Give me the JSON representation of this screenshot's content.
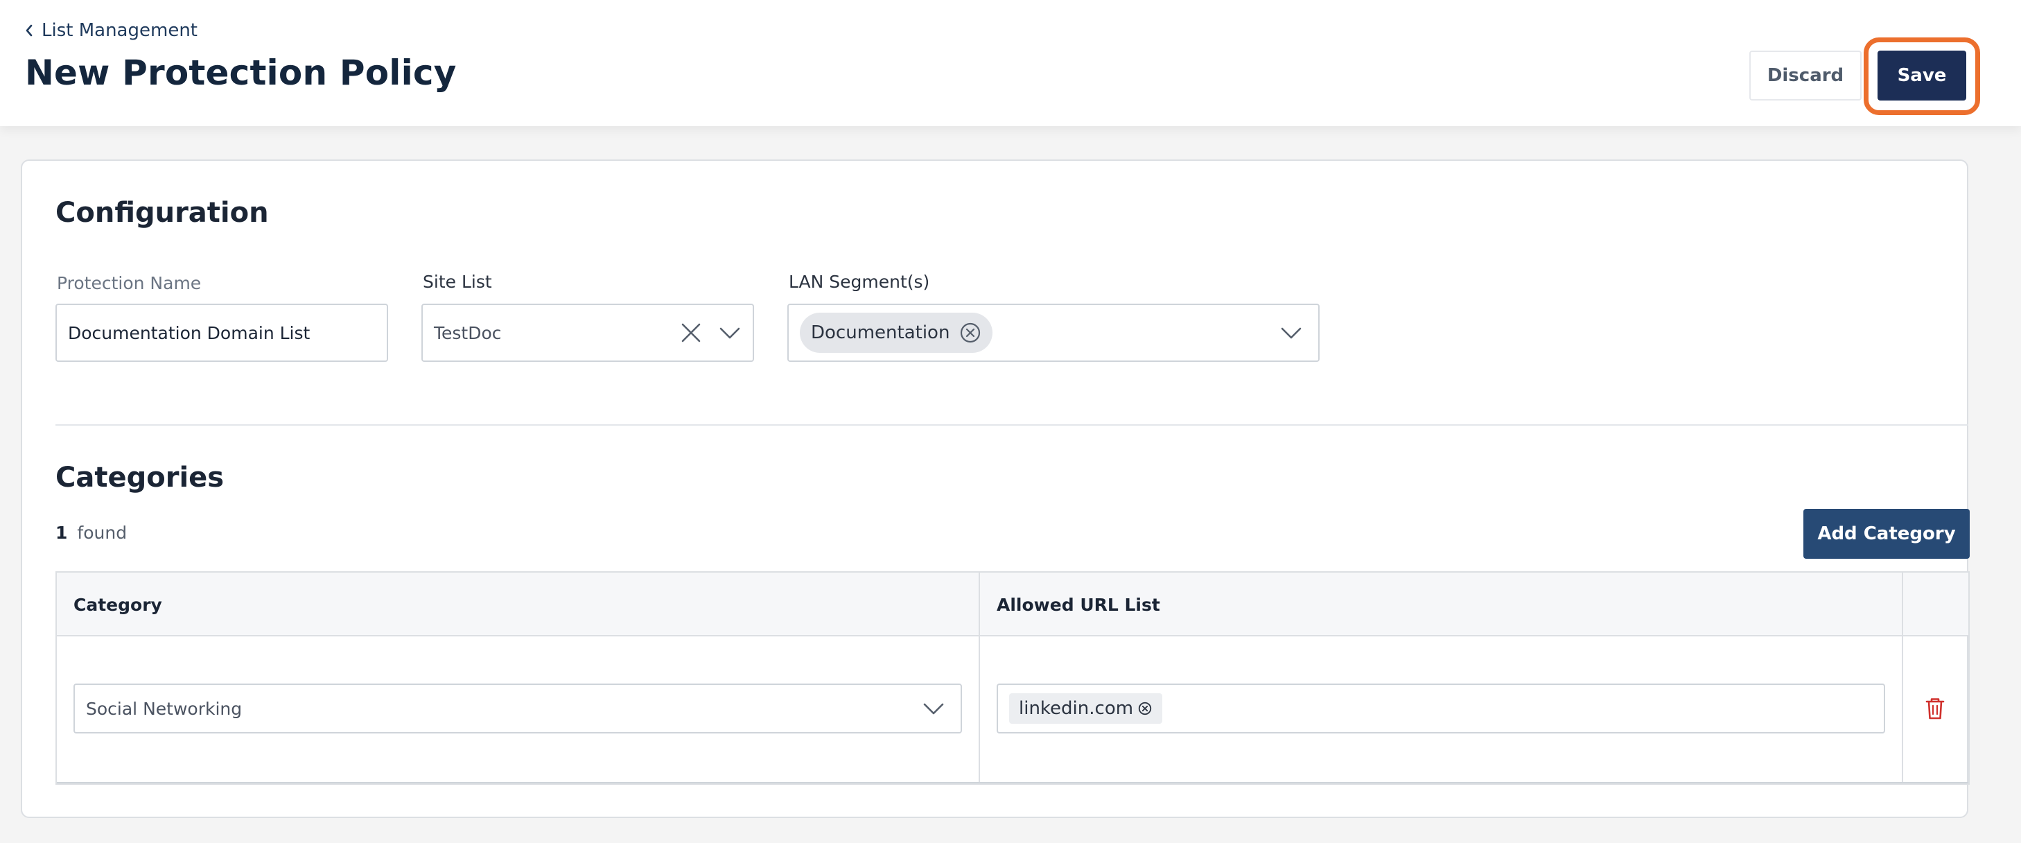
{
  "header": {
    "breadcrumb": "List Management",
    "title": "New Protection Policy",
    "discard_label": "Discard",
    "save_label": "Save"
  },
  "configuration": {
    "title": "Configuration",
    "protection_name": {
      "label": "Protection Name",
      "value": "Documentation Domain List"
    },
    "site_list": {
      "label": "Site List",
      "value": "TestDoc"
    },
    "lan_segments": {
      "label": "LAN Segment(s)",
      "chips": [
        "Documentation"
      ]
    }
  },
  "categories": {
    "title": "Categories",
    "count": "1",
    "count_label": "found",
    "add_label": "Add Category",
    "columns": [
      "Category",
      "Allowed URL List"
    ],
    "rows": [
      {
        "category": "Social Networking",
        "urls": [
          "linkedin.com"
        ]
      }
    ]
  },
  "icons": {
    "back": "chevron-left-icon",
    "clear": "close-icon",
    "dropdown": "chevron-down-icon",
    "chip_remove": "circle-x-icon",
    "delete": "trash-icon"
  },
  "colors": {
    "primary": "#1c2e56",
    "secondary": "#274a75",
    "highlight": "#ec6f2d",
    "danger": "#d0312d"
  }
}
